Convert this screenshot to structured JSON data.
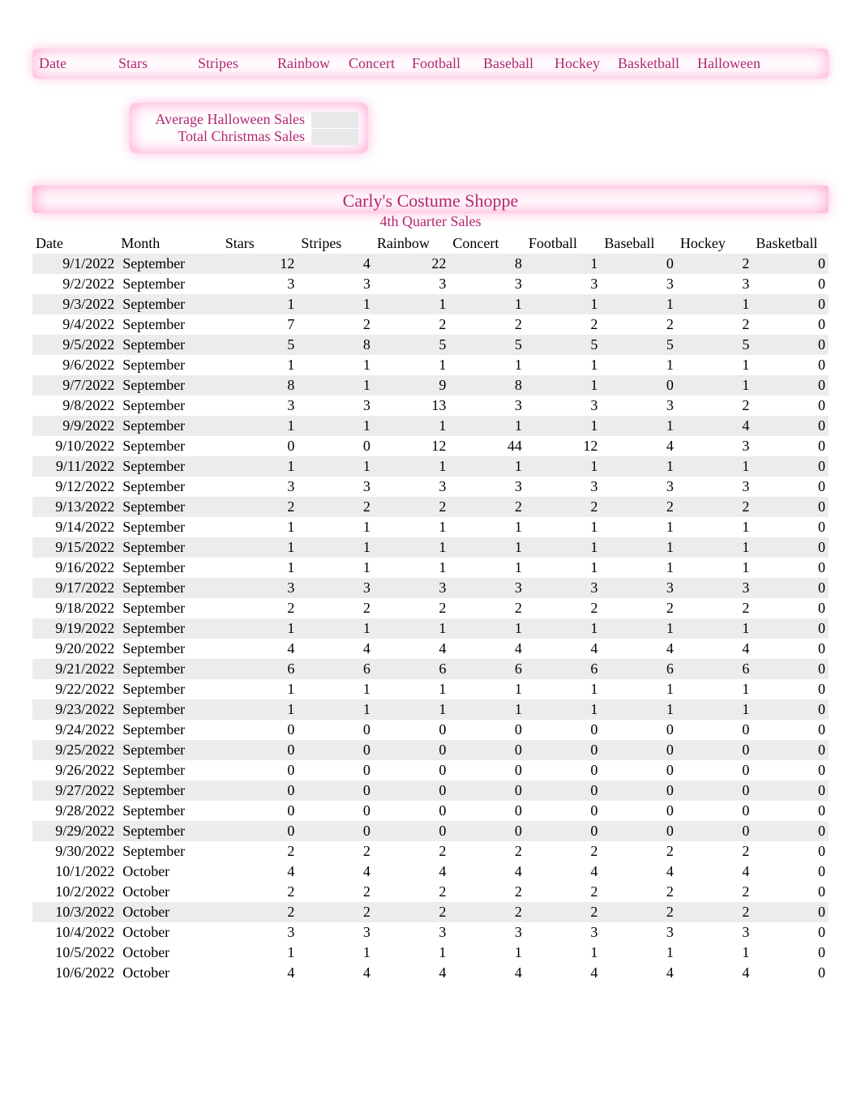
{
  "top_headers": [
    "Date",
    "Stars",
    "Stripes",
    "Rainbow",
    "Concert",
    "Football",
    "Baseball",
    "Hockey",
    "Basketball",
    "Halloween"
  ],
  "top_header_widths": [
    90,
    90,
    90,
    80,
    70,
    80,
    80,
    70,
    90,
    90
  ],
  "summary": {
    "avg_halloween_label": "Average Halloween Sales",
    "total_christmas_label": "Total Christmas Sales"
  },
  "table": {
    "title": "Carly's Costume Shoppe",
    "subtitle": "4th Quarter Sales",
    "headers": [
      "Date",
      "Month",
      "Stars",
      "Stripes",
      "Rainbow",
      "Concert",
      "Football",
      "Baseball",
      "Hockey",
      "Basketball"
    ],
    "rows": [
      {
        "date": "9/1/2022",
        "month": "September",
        "vals": [
          12,
          4,
          22,
          8,
          1,
          0,
          2,
          0
        ]
      },
      {
        "date": "9/2/2022",
        "month": "September",
        "vals": [
          3,
          3,
          3,
          3,
          3,
          3,
          3,
          0
        ]
      },
      {
        "date": "9/3/2022",
        "month": "September",
        "vals": [
          1,
          1,
          1,
          1,
          1,
          1,
          1,
          0
        ]
      },
      {
        "date": "9/4/2022",
        "month": "September",
        "vals": [
          7,
          2,
          2,
          2,
          2,
          2,
          2,
          0
        ]
      },
      {
        "date": "9/5/2022",
        "month": "September",
        "vals": [
          5,
          8,
          5,
          5,
          5,
          5,
          5,
          0
        ]
      },
      {
        "date": "9/6/2022",
        "month": "September",
        "vals": [
          1,
          1,
          1,
          1,
          1,
          1,
          1,
          0
        ]
      },
      {
        "date": "9/7/2022",
        "month": "September",
        "vals": [
          8,
          1,
          9,
          8,
          1,
          0,
          1,
          0
        ]
      },
      {
        "date": "9/8/2022",
        "month": "September",
        "vals": [
          3,
          3,
          13,
          3,
          3,
          3,
          2,
          0
        ]
      },
      {
        "date": "9/9/2022",
        "month": "September",
        "vals": [
          1,
          1,
          1,
          1,
          1,
          1,
          4,
          0
        ]
      },
      {
        "date": "9/10/2022",
        "month": "September",
        "vals": [
          0,
          0,
          12,
          44,
          12,
          4,
          3,
          0
        ]
      },
      {
        "date": "9/11/2022",
        "month": "September",
        "vals": [
          1,
          1,
          1,
          1,
          1,
          1,
          1,
          0
        ]
      },
      {
        "date": "9/12/2022",
        "month": "September",
        "vals": [
          3,
          3,
          3,
          3,
          3,
          3,
          3,
          0
        ]
      },
      {
        "date": "9/13/2022",
        "month": "September",
        "vals": [
          2,
          2,
          2,
          2,
          2,
          2,
          2,
          0
        ]
      },
      {
        "date": "9/14/2022",
        "month": "September",
        "vals": [
          1,
          1,
          1,
          1,
          1,
          1,
          1,
          0
        ]
      },
      {
        "date": "9/15/2022",
        "month": "September",
        "vals": [
          1,
          1,
          1,
          1,
          1,
          1,
          1,
          0
        ]
      },
      {
        "date": "9/16/2022",
        "month": "September",
        "vals": [
          1,
          1,
          1,
          1,
          1,
          1,
          1,
          0
        ]
      },
      {
        "date": "9/17/2022",
        "month": "September",
        "vals": [
          3,
          3,
          3,
          3,
          3,
          3,
          3,
          0
        ]
      },
      {
        "date": "9/18/2022",
        "month": "September",
        "vals": [
          2,
          2,
          2,
          2,
          2,
          2,
          2,
          0
        ]
      },
      {
        "date": "9/19/2022",
        "month": "September",
        "vals": [
          1,
          1,
          1,
          1,
          1,
          1,
          1,
          0
        ]
      },
      {
        "date": "9/20/2022",
        "month": "September",
        "vals": [
          4,
          4,
          4,
          4,
          4,
          4,
          4,
          0
        ]
      },
      {
        "date": "9/21/2022",
        "month": "September",
        "vals": [
          6,
          6,
          6,
          6,
          6,
          6,
          6,
          0
        ]
      },
      {
        "date": "9/22/2022",
        "month": "September",
        "vals": [
          1,
          1,
          1,
          1,
          1,
          1,
          1,
          0
        ]
      },
      {
        "date": "9/23/2022",
        "month": "September",
        "vals": [
          1,
          1,
          1,
          1,
          1,
          1,
          1,
          0
        ]
      },
      {
        "date": "9/24/2022",
        "month": "September",
        "vals": [
          0,
          0,
          0,
          0,
          0,
          0,
          0,
          0
        ]
      },
      {
        "date": "9/25/2022",
        "month": "September",
        "vals": [
          0,
          0,
          0,
          0,
          0,
          0,
          0,
          0
        ]
      },
      {
        "date": "9/26/2022",
        "month": "September",
        "vals": [
          0,
          0,
          0,
          0,
          0,
          0,
          0,
          0
        ]
      },
      {
        "date": "9/27/2022",
        "month": "September",
        "vals": [
          0,
          0,
          0,
          0,
          0,
          0,
          0,
          0
        ]
      },
      {
        "date": "9/28/2022",
        "month": "September",
        "vals": [
          0,
          0,
          0,
          0,
          0,
          0,
          0,
          0
        ]
      },
      {
        "date": "9/29/2022",
        "month": "September",
        "vals": [
          0,
          0,
          0,
          0,
          0,
          0,
          0,
          0
        ]
      },
      {
        "date": "9/30/2022",
        "month": "September",
        "vals": [
          2,
          2,
          2,
          2,
          2,
          2,
          2,
          0
        ]
      },
      {
        "date": "10/1/2022",
        "month": "October",
        "vals": [
          4,
          4,
          4,
          4,
          4,
          4,
          4,
          0
        ]
      },
      {
        "date": "10/2/2022",
        "month": "October",
        "vals": [
          2,
          2,
          2,
          2,
          2,
          2,
          2,
          0
        ]
      },
      {
        "date": "10/3/2022",
        "month": "October",
        "vals": [
          2,
          2,
          2,
          2,
          2,
          2,
          2,
          0
        ]
      },
      {
        "date": "10/4/2022",
        "month": "October",
        "vals": [
          3,
          3,
          3,
          3,
          3,
          3,
          3,
          0
        ]
      },
      {
        "date": "10/5/2022",
        "month": "October",
        "vals": [
          1,
          1,
          1,
          1,
          1,
          1,
          1,
          0
        ]
      },
      {
        "date": "10/6/2022",
        "month": "October",
        "vals": [
          4,
          4,
          4,
          4,
          4,
          4,
          4,
          0
        ]
      }
    ],
    "shaded_row_indices": [
      0,
      2,
      4,
      6,
      8,
      10,
      12,
      14,
      16,
      18,
      20,
      22,
      24,
      26,
      28,
      32
    ]
  }
}
